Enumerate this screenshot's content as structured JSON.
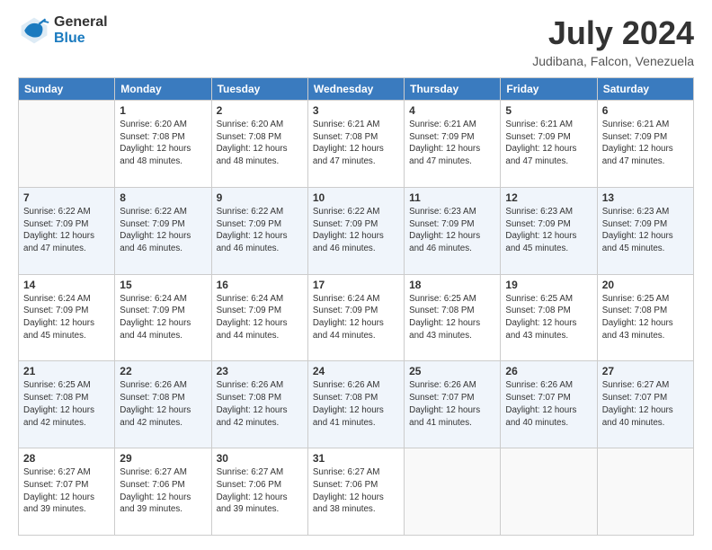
{
  "header": {
    "logo_line1": "General",
    "logo_line2": "Blue",
    "month": "July 2024",
    "location": "Judibana, Falcon, Venezuela"
  },
  "days_of_week": [
    "Sunday",
    "Monday",
    "Tuesday",
    "Wednesday",
    "Thursday",
    "Friday",
    "Saturday"
  ],
  "weeks": [
    [
      {
        "day": "",
        "info": ""
      },
      {
        "day": "1",
        "info": "Sunrise: 6:20 AM\nSunset: 7:08 PM\nDaylight: 12 hours\nand 48 minutes."
      },
      {
        "day": "2",
        "info": "Sunrise: 6:20 AM\nSunset: 7:08 PM\nDaylight: 12 hours\nand 48 minutes."
      },
      {
        "day": "3",
        "info": "Sunrise: 6:21 AM\nSunset: 7:08 PM\nDaylight: 12 hours\nand 47 minutes."
      },
      {
        "day": "4",
        "info": "Sunrise: 6:21 AM\nSunset: 7:09 PM\nDaylight: 12 hours\nand 47 minutes."
      },
      {
        "day": "5",
        "info": "Sunrise: 6:21 AM\nSunset: 7:09 PM\nDaylight: 12 hours\nand 47 minutes."
      },
      {
        "day": "6",
        "info": "Sunrise: 6:21 AM\nSunset: 7:09 PM\nDaylight: 12 hours\nand 47 minutes."
      }
    ],
    [
      {
        "day": "7",
        "info": "Sunrise: 6:22 AM\nSunset: 7:09 PM\nDaylight: 12 hours\nand 47 minutes."
      },
      {
        "day": "8",
        "info": "Sunrise: 6:22 AM\nSunset: 7:09 PM\nDaylight: 12 hours\nand 46 minutes."
      },
      {
        "day": "9",
        "info": "Sunrise: 6:22 AM\nSunset: 7:09 PM\nDaylight: 12 hours\nand 46 minutes."
      },
      {
        "day": "10",
        "info": "Sunrise: 6:22 AM\nSunset: 7:09 PM\nDaylight: 12 hours\nand 46 minutes."
      },
      {
        "day": "11",
        "info": "Sunrise: 6:23 AM\nSunset: 7:09 PM\nDaylight: 12 hours\nand 46 minutes."
      },
      {
        "day": "12",
        "info": "Sunrise: 6:23 AM\nSunset: 7:09 PM\nDaylight: 12 hours\nand 45 minutes."
      },
      {
        "day": "13",
        "info": "Sunrise: 6:23 AM\nSunset: 7:09 PM\nDaylight: 12 hours\nand 45 minutes."
      }
    ],
    [
      {
        "day": "14",
        "info": "Sunrise: 6:24 AM\nSunset: 7:09 PM\nDaylight: 12 hours\nand 45 minutes."
      },
      {
        "day": "15",
        "info": "Sunrise: 6:24 AM\nSunset: 7:09 PM\nDaylight: 12 hours\nand 44 minutes."
      },
      {
        "day": "16",
        "info": "Sunrise: 6:24 AM\nSunset: 7:09 PM\nDaylight: 12 hours\nand 44 minutes."
      },
      {
        "day": "17",
        "info": "Sunrise: 6:24 AM\nSunset: 7:09 PM\nDaylight: 12 hours\nand 44 minutes."
      },
      {
        "day": "18",
        "info": "Sunrise: 6:25 AM\nSunset: 7:08 PM\nDaylight: 12 hours\nand 43 minutes."
      },
      {
        "day": "19",
        "info": "Sunrise: 6:25 AM\nSunset: 7:08 PM\nDaylight: 12 hours\nand 43 minutes."
      },
      {
        "day": "20",
        "info": "Sunrise: 6:25 AM\nSunset: 7:08 PM\nDaylight: 12 hours\nand 43 minutes."
      }
    ],
    [
      {
        "day": "21",
        "info": "Sunrise: 6:25 AM\nSunset: 7:08 PM\nDaylight: 12 hours\nand 42 minutes."
      },
      {
        "day": "22",
        "info": "Sunrise: 6:26 AM\nSunset: 7:08 PM\nDaylight: 12 hours\nand 42 minutes."
      },
      {
        "day": "23",
        "info": "Sunrise: 6:26 AM\nSunset: 7:08 PM\nDaylight: 12 hours\nand 42 minutes."
      },
      {
        "day": "24",
        "info": "Sunrise: 6:26 AM\nSunset: 7:08 PM\nDaylight: 12 hours\nand 41 minutes."
      },
      {
        "day": "25",
        "info": "Sunrise: 6:26 AM\nSunset: 7:07 PM\nDaylight: 12 hours\nand 41 minutes."
      },
      {
        "day": "26",
        "info": "Sunrise: 6:26 AM\nSunset: 7:07 PM\nDaylight: 12 hours\nand 40 minutes."
      },
      {
        "day": "27",
        "info": "Sunrise: 6:27 AM\nSunset: 7:07 PM\nDaylight: 12 hours\nand 40 minutes."
      }
    ],
    [
      {
        "day": "28",
        "info": "Sunrise: 6:27 AM\nSunset: 7:07 PM\nDaylight: 12 hours\nand 39 minutes."
      },
      {
        "day": "29",
        "info": "Sunrise: 6:27 AM\nSunset: 7:06 PM\nDaylight: 12 hours\nand 39 minutes."
      },
      {
        "day": "30",
        "info": "Sunrise: 6:27 AM\nSunset: 7:06 PM\nDaylight: 12 hours\nand 39 minutes."
      },
      {
        "day": "31",
        "info": "Sunrise: 6:27 AM\nSunset: 7:06 PM\nDaylight: 12 hours\nand 38 minutes."
      },
      {
        "day": "",
        "info": ""
      },
      {
        "day": "",
        "info": ""
      },
      {
        "day": "",
        "info": ""
      }
    ]
  ]
}
